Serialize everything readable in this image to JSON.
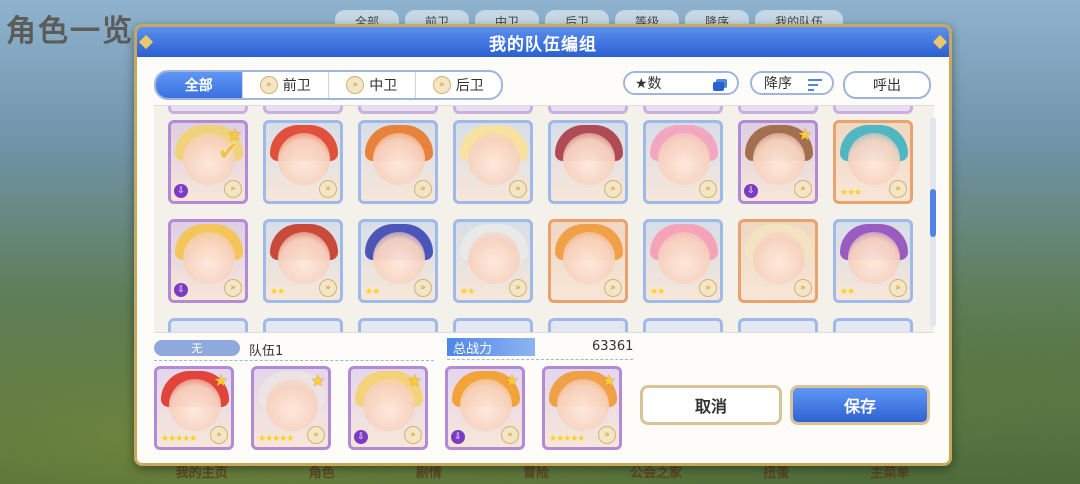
{
  "background": {
    "title": "角色一览",
    "tabs": [
      "全部",
      "前卫",
      "中卫",
      "后卫",
      "等级",
      "降序",
      "我的队伍"
    ],
    "bottom_nav": [
      "我的主页",
      "角色",
      "剧情",
      "冒险",
      "公会之家",
      "扭蛋",
      "主菜单"
    ]
  },
  "dialog": {
    "title": "我的队伍编组",
    "filters": [
      {
        "label": "全部",
        "active": true
      },
      {
        "label": "前卫",
        "active": false
      },
      {
        "label": "中卫",
        "active": false
      },
      {
        "label": "后卫",
        "active": false
      }
    ],
    "sort_field": "★数",
    "sort_order": "降序",
    "call_button": "呼出"
  },
  "roster": [
    {
      "hair": "#f0d27a",
      "frame": "#b28ad6",
      "selected": true,
      "star": true,
      "down": true,
      "stars": ""
    },
    {
      "hair": "#e0503a",
      "frame": "#9fb9e8",
      "selected": false,
      "star": false,
      "down": false,
      "stars": ""
    },
    {
      "hair": "#e8823a",
      "frame": "#9fb9e8",
      "selected": false,
      "star": false,
      "down": false,
      "stars": ""
    },
    {
      "hair": "#f7e2a0",
      "frame": "#9fb9e8",
      "selected": false,
      "star": false,
      "down": false,
      "stars": ""
    },
    {
      "hair": "#b04b54",
      "frame": "#9fb9e8",
      "selected": false,
      "star": false,
      "down": false,
      "stars": ""
    },
    {
      "hair": "#f2a7c0",
      "frame": "#9fb9e8",
      "selected": false,
      "star": false,
      "down": false,
      "stars": ""
    },
    {
      "hair": "#a2704f",
      "frame": "#b28ad6",
      "selected": false,
      "star": true,
      "down": true,
      "stars": ""
    },
    {
      "hair": "#4fb6c2",
      "frame": "#e8a36e",
      "selected": false,
      "star": false,
      "down": false,
      "stars": "★★★"
    },
    {
      "hair": "#f3c55a",
      "frame": "#b28ad6",
      "selected": false,
      "star": false,
      "down": true,
      "stars": ""
    },
    {
      "hair": "#c9493a",
      "frame": "#9fb9e8",
      "selected": false,
      "star": false,
      "down": false,
      "stars": "★★"
    },
    {
      "hair": "#4c56b8",
      "frame": "#9fb9e8",
      "selected": false,
      "star": false,
      "down": false,
      "stars": "★★"
    },
    {
      "hair": "#e9e9e9",
      "frame": "#9fb9e8",
      "selected": false,
      "star": false,
      "down": false,
      "stars": "★★"
    },
    {
      "hair": "#f0a046",
      "frame": "#e8a36e",
      "selected": false,
      "star": false,
      "down": false,
      "stars": ""
    },
    {
      "hair": "#f4a3b8",
      "frame": "#9fb9e8",
      "selected": false,
      "star": false,
      "down": false,
      "stars": "★★"
    },
    {
      "hair": "#f3e3c2",
      "frame": "#e8a36e",
      "selected": false,
      "star": false,
      "down": false,
      "stars": ""
    },
    {
      "hair": "#9a5cc0",
      "frame": "#9fb9e8",
      "selected": false,
      "star": false,
      "down": false,
      "stars": "★★"
    }
  ],
  "team": {
    "badge": "无",
    "name": "队伍1",
    "power_label": "总战力",
    "power_value": "63361",
    "members": [
      {
        "hair": "#e0443a",
        "stars": "★★★★★"
      },
      {
        "hair": "#ece4e4",
        "stars": "★★★★★"
      },
      {
        "hair": "#f4d27a",
        "stars": ""
      },
      {
        "hair": "#f2a43a",
        "stars": ""
      },
      {
        "hair": "#f0a046",
        "stars": "★★★★★"
      }
    ]
  },
  "buttons": {
    "cancel": "取消",
    "save": "保存"
  }
}
